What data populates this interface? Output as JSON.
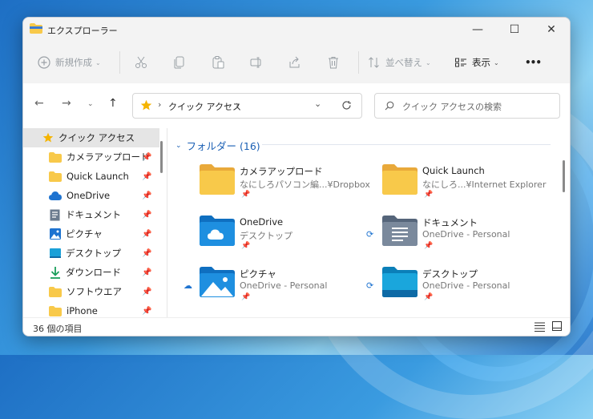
{
  "window": {
    "title": "エクスプローラー"
  },
  "titlebar": {
    "minimize": "—",
    "maximize": "☐",
    "close": "✕"
  },
  "toolbar": {
    "new_label": "新規作成",
    "sort_label": "並べ替え",
    "view_label": "表示",
    "more_label": "•••"
  },
  "address": {
    "current": "クイック アクセス"
  },
  "search": {
    "placeholder": "クイック アクセスの検索"
  },
  "sidebar": {
    "items": [
      {
        "label": "クイック アクセス",
        "icon": "star-icon",
        "pinned": false
      },
      {
        "label": "カメラアップロード",
        "icon": "folder-icon",
        "pinned": true
      },
      {
        "label": "Quick Launch",
        "icon": "folder-icon",
        "pinned": true
      },
      {
        "label": "OneDrive",
        "icon": "cloud-icon",
        "pinned": true
      },
      {
        "label": "ドキュメント",
        "icon": "document-icon",
        "pinned": true
      },
      {
        "label": "ピクチャ",
        "icon": "pictures-icon",
        "pinned": true
      },
      {
        "label": "デスクトップ",
        "icon": "desktop-icon",
        "pinned": true
      },
      {
        "label": "ダウンロード",
        "icon": "download-icon",
        "pinned": true
      },
      {
        "label": "ソフトウエア",
        "icon": "folder-icon",
        "pinned": true
      },
      {
        "label": "iPhone",
        "icon": "folder-icon",
        "pinned": true
      }
    ]
  },
  "content": {
    "group_label": "フォルダー (16)",
    "tiles": [
      {
        "name": "カメラアップロード",
        "sub": "なにしろパソコン編...¥Dropbox",
        "icon": "folder-icon"
      },
      {
        "name": "Quick Launch",
        "sub": "なにしろ...¥Internet Explorer",
        "icon": "folder-icon"
      },
      {
        "name": "OneDrive",
        "sub": "デスクトップ",
        "icon": "onedrive-folder-icon"
      },
      {
        "name": "ドキュメント",
        "sub": "OneDrive - Personal",
        "icon": "documents-folder-icon"
      },
      {
        "name": "ピクチャ",
        "sub": "OneDrive - Personal",
        "icon": "pictures-folder-icon"
      },
      {
        "name": "デスクトップ",
        "sub": "OneDrive - Personal",
        "icon": "desktop-folder-icon"
      }
    ]
  },
  "status": {
    "item_count": "36 個の項目"
  },
  "colors": {
    "accent": "#1a5fb4",
    "folder": "#f8c94a",
    "folder_dark": "#e9a93a",
    "blue_folder": "#1e8fe0"
  }
}
